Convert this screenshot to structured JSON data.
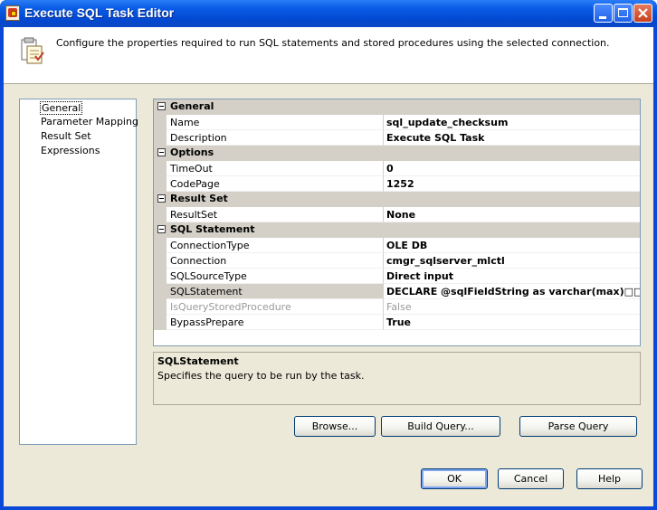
{
  "window": {
    "title": "Execute SQL Task Editor"
  },
  "header": {
    "text": "Configure the properties required to run SQL statements and stored procedures using the selected connection."
  },
  "nav": {
    "items": [
      "General",
      "Parameter Mapping",
      "Result Set",
      "Expressions"
    ],
    "selected": "General"
  },
  "grid": {
    "categories": [
      {
        "label": "General",
        "props": [
          {
            "name": "Name",
            "value": "sql_update_checksum"
          },
          {
            "name": "Description",
            "value": "Execute SQL Task"
          }
        ]
      },
      {
        "label": "Options",
        "props": [
          {
            "name": "TimeOut",
            "value": "0"
          },
          {
            "name": "CodePage",
            "value": "1252"
          }
        ]
      },
      {
        "label": "Result Set",
        "props": [
          {
            "name": "ResultSet",
            "value": "None"
          }
        ]
      },
      {
        "label": "SQL Statement",
        "props": [
          {
            "name": "ConnectionType",
            "value": "OLE DB"
          },
          {
            "name": "Connection",
            "value": "cmgr_sqlserver_mlctl"
          },
          {
            "name": "SQLSourceType",
            "value": "Direct input"
          },
          {
            "name": "SQLStatement",
            "value": "DECLARE @sqlFieldString as varchar(max)□□DEC"
          },
          {
            "name": "IsQueryStoredProcedure",
            "value": "False"
          },
          {
            "name": "BypassPrepare",
            "value": "True"
          }
        ]
      }
    ]
  },
  "description": {
    "title": "SQLStatement",
    "text": "Specifies the query to be run by the task."
  },
  "buttons": {
    "browse": "Browse...",
    "build_query": "Build Query...",
    "parse_query": "Parse Query",
    "ok": "OK",
    "cancel": "Cancel",
    "help": "Help"
  }
}
